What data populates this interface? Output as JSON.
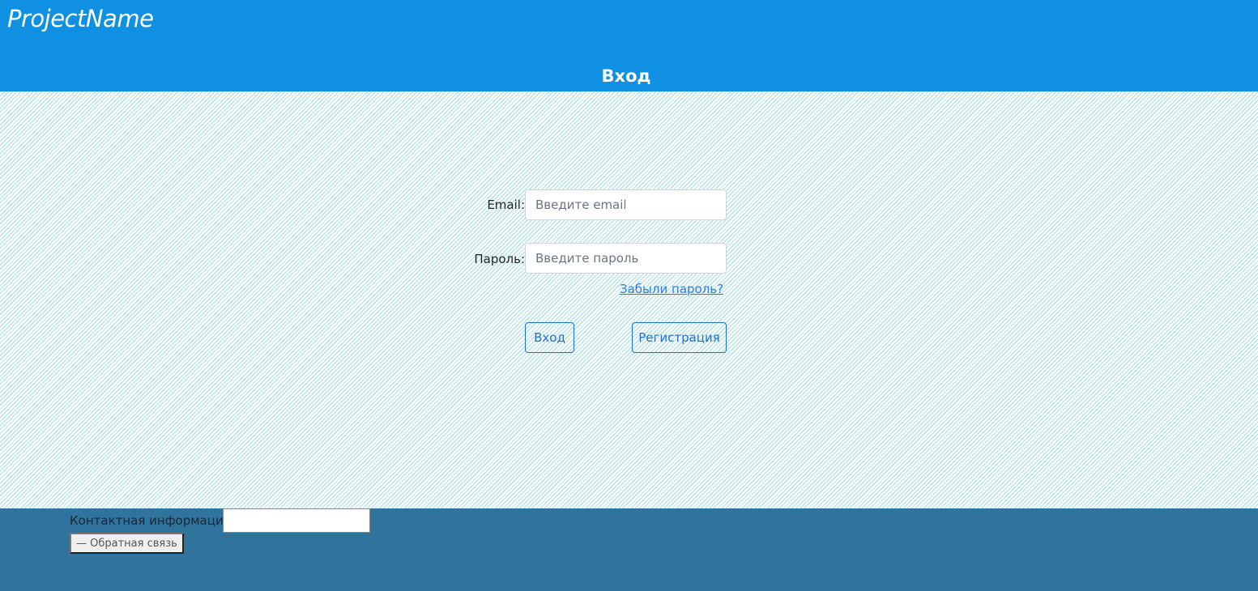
{
  "header": {
    "brand": "ProjectName",
    "page_title": "Вход"
  },
  "login_form": {
    "email_label": "Email:",
    "email_placeholder": "Введите email",
    "password_label": "Пароль:",
    "password_placeholder": "Введите пароль",
    "forgot_password": "Забыли пароль?",
    "login_button": "Вход",
    "register_button": "Регистрация"
  },
  "footer": {
    "contact_label": "Контактная информация:",
    "feedback_button": "— Обратная связь"
  },
  "colors": {
    "header_bg": "#1090e2",
    "footer_bg": "#30739d",
    "accent": "#1d6fd0",
    "pattern_line": "#9fdde0"
  }
}
